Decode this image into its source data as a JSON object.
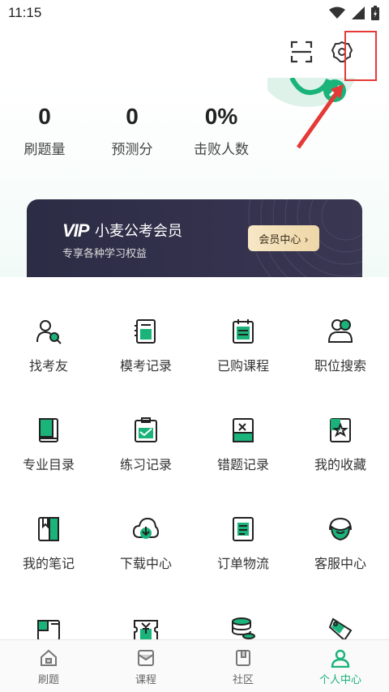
{
  "status_bar": {
    "time": "11:15"
  },
  "stats": [
    {
      "value": "0",
      "label": "刷题量"
    },
    {
      "value": "0",
      "label": "预测分"
    },
    {
      "value": "0%",
      "label": "击败人数"
    }
  ],
  "vip": {
    "logo": "VIP",
    "title": "小麦公考会员",
    "subtitle": "专享各种学习权益",
    "button": "会员中心 ›"
  },
  "grid": [
    {
      "label": "找考友",
      "icon": "find-friend-icon"
    },
    {
      "label": "模考记录",
      "icon": "mock-record-icon"
    },
    {
      "label": "已购课程",
      "icon": "purchased-course-icon"
    },
    {
      "label": "职位搜索",
      "icon": "job-search-icon"
    },
    {
      "label": "专业目录",
      "icon": "major-catalog-icon"
    },
    {
      "label": "练习记录",
      "icon": "practice-record-icon"
    },
    {
      "label": "错题记录",
      "icon": "wrong-record-icon"
    },
    {
      "label": "我的收藏",
      "icon": "favorites-icon"
    },
    {
      "label": "我的笔记",
      "icon": "notes-icon"
    },
    {
      "label": "下载中心",
      "icon": "download-icon"
    },
    {
      "label": "订单物流",
      "icon": "order-icon"
    },
    {
      "label": "客服中心",
      "icon": "service-icon"
    },
    {
      "label": "",
      "icon": "wallet-icon"
    },
    {
      "label": "",
      "icon": "coupon-icon"
    },
    {
      "label": "",
      "icon": "coins-icon"
    },
    {
      "label": "",
      "icon": "gift-icon"
    }
  ],
  "tabs": [
    {
      "label": "刷题",
      "icon": "home-icon",
      "active": false
    },
    {
      "label": "课程",
      "icon": "course-icon",
      "active": false
    },
    {
      "label": "社区",
      "icon": "community-icon",
      "active": false
    },
    {
      "label": "个人中心",
      "icon": "profile-icon",
      "active": true
    }
  ],
  "colors": {
    "accent": "#1ab37a",
    "vip_bg": "#2c2c45",
    "highlight": "#e53935"
  }
}
